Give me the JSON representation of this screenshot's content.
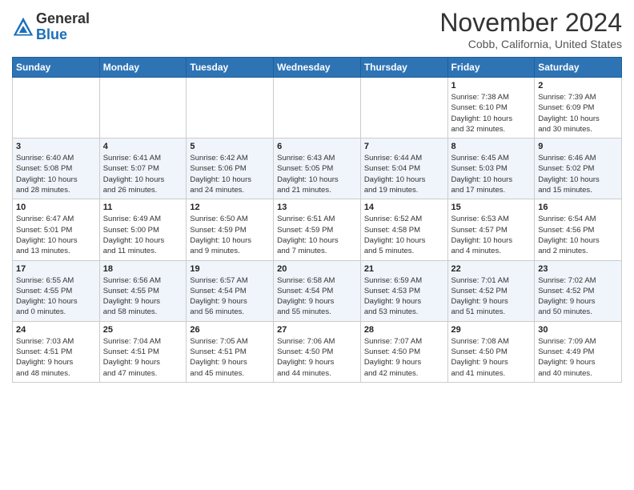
{
  "header": {
    "logo_general": "General",
    "logo_blue": "Blue",
    "month_title": "November 2024",
    "location": "Cobb, California, United States"
  },
  "weekdays": [
    "Sunday",
    "Monday",
    "Tuesday",
    "Wednesday",
    "Thursday",
    "Friday",
    "Saturday"
  ],
  "weeks": [
    [
      {
        "day": "",
        "info": ""
      },
      {
        "day": "",
        "info": ""
      },
      {
        "day": "",
        "info": ""
      },
      {
        "day": "",
        "info": ""
      },
      {
        "day": "",
        "info": ""
      },
      {
        "day": "1",
        "info": "Sunrise: 7:38 AM\nSunset: 6:10 PM\nDaylight: 10 hours\nand 32 minutes."
      },
      {
        "day": "2",
        "info": "Sunrise: 7:39 AM\nSunset: 6:09 PM\nDaylight: 10 hours\nand 30 minutes."
      }
    ],
    [
      {
        "day": "3",
        "info": "Sunrise: 6:40 AM\nSunset: 5:08 PM\nDaylight: 10 hours\nand 28 minutes."
      },
      {
        "day": "4",
        "info": "Sunrise: 6:41 AM\nSunset: 5:07 PM\nDaylight: 10 hours\nand 26 minutes."
      },
      {
        "day": "5",
        "info": "Sunrise: 6:42 AM\nSunset: 5:06 PM\nDaylight: 10 hours\nand 24 minutes."
      },
      {
        "day": "6",
        "info": "Sunrise: 6:43 AM\nSunset: 5:05 PM\nDaylight: 10 hours\nand 21 minutes."
      },
      {
        "day": "7",
        "info": "Sunrise: 6:44 AM\nSunset: 5:04 PM\nDaylight: 10 hours\nand 19 minutes."
      },
      {
        "day": "8",
        "info": "Sunrise: 6:45 AM\nSunset: 5:03 PM\nDaylight: 10 hours\nand 17 minutes."
      },
      {
        "day": "9",
        "info": "Sunrise: 6:46 AM\nSunset: 5:02 PM\nDaylight: 10 hours\nand 15 minutes."
      }
    ],
    [
      {
        "day": "10",
        "info": "Sunrise: 6:47 AM\nSunset: 5:01 PM\nDaylight: 10 hours\nand 13 minutes."
      },
      {
        "day": "11",
        "info": "Sunrise: 6:49 AM\nSunset: 5:00 PM\nDaylight: 10 hours\nand 11 minutes."
      },
      {
        "day": "12",
        "info": "Sunrise: 6:50 AM\nSunset: 4:59 PM\nDaylight: 10 hours\nand 9 minutes."
      },
      {
        "day": "13",
        "info": "Sunrise: 6:51 AM\nSunset: 4:59 PM\nDaylight: 10 hours\nand 7 minutes."
      },
      {
        "day": "14",
        "info": "Sunrise: 6:52 AM\nSunset: 4:58 PM\nDaylight: 10 hours\nand 5 minutes."
      },
      {
        "day": "15",
        "info": "Sunrise: 6:53 AM\nSunset: 4:57 PM\nDaylight: 10 hours\nand 4 minutes."
      },
      {
        "day": "16",
        "info": "Sunrise: 6:54 AM\nSunset: 4:56 PM\nDaylight: 10 hours\nand 2 minutes."
      }
    ],
    [
      {
        "day": "17",
        "info": "Sunrise: 6:55 AM\nSunset: 4:55 PM\nDaylight: 10 hours\nand 0 minutes."
      },
      {
        "day": "18",
        "info": "Sunrise: 6:56 AM\nSunset: 4:55 PM\nDaylight: 9 hours\nand 58 minutes."
      },
      {
        "day": "19",
        "info": "Sunrise: 6:57 AM\nSunset: 4:54 PM\nDaylight: 9 hours\nand 56 minutes."
      },
      {
        "day": "20",
        "info": "Sunrise: 6:58 AM\nSunset: 4:54 PM\nDaylight: 9 hours\nand 55 minutes."
      },
      {
        "day": "21",
        "info": "Sunrise: 6:59 AM\nSunset: 4:53 PM\nDaylight: 9 hours\nand 53 minutes."
      },
      {
        "day": "22",
        "info": "Sunrise: 7:01 AM\nSunset: 4:52 PM\nDaylight: 9 hours\nand 51 minutes."
      },
      {
        "day": "23",
        "info": "Sunrise: 7:02 AM\nSunset: 4:52 PM\nDaylight: 9 hours\nand 50 minutes."
      }
    ],
    [
      {
        "day": "24",
        "info": "Sunrise: 7:03 AM\nSunset: 4:51 PM\nDaylight: 9 hours\nand 48 minutes."
      },
      {
        "day": "25",
        "info": "Sunrise: 7:04 AM\nSunset: 4:51 PM\nDaylight: 9 hours\nand 47 minutes."
      },
      {
        "day": "26",
        "info": "Sunrise: 7:05 AM\nSunset: 4:51 PM\nDaylight: 9 hours\nand 45 minutes."
      },
      {
        "day": "27",
        "info": "Sunrise: 7:06 AM\nSunset: 4:50 PM\nDaylight: 9 hours\nand 44 minutes."
      },
      {
        "day": "28",
        "info": "Sunrise: 7:07 AM\nSunset: 4:50 PM\nDaylight: 9 hours\nand 42 minutes."
      },
      {
        "day": "29",
        "info": "Sunrise: 7:08 AM\nSunset: 4:50 PM\nDaylight: 9 hours\nand 41 minutes."
      },
      {
        "day": "30",
        "info": "Sunrise: 7:09 AM\nSunset: 4:49 PM\nDaylight: 9 hours\nand 40 minutes."
      }
    ]
  ]
}
